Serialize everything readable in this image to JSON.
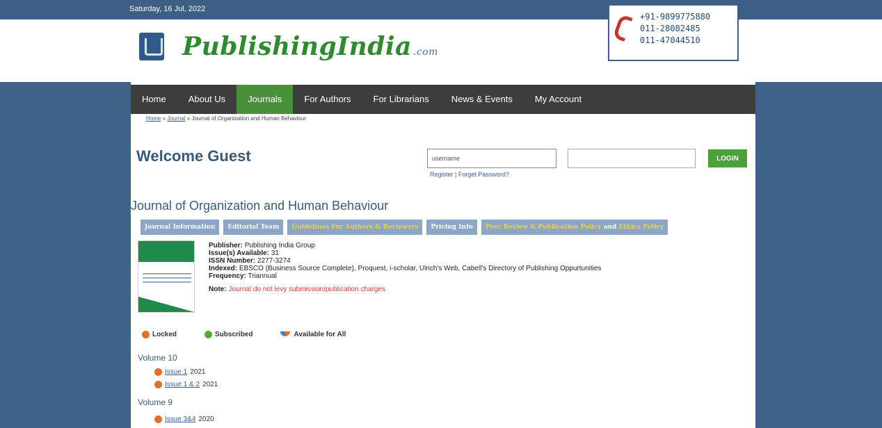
{
  "topbar": {
    "date": "Saturday, 16 Jul, 2022"
  },
  "logo": {
    "name": "PublishingIndia",
    "domain": ".com"
  },
  "contact": {
    "phones": [
      "+91-9899775880",
      "011-28082485",
      "011-47044510"
    ]
  },
  "nav": {
    "items": [
      {
        "label": "Home"
      },
      {
        "label": "About Us"
      },
      {
        "label": "Journals",
        "active": true
      },
      {
        "label": "For Authors"
      },
      {
        "label": "For Librarians"
      },
      {
        "label": "News & Events"
      },
      {
        "label": "My Account"
      }
    ]
  },
  "breadcrumb": {
    "home": "Home",
    "sep": "»",
    "journal": "Journal",
    "current": "Journal of Organization and Human Behaviour"
  },
  "login": {
    "welcome": "Welcome Guest",
    "username_value": "username",
    "login_label": "LOGIN",
    "register": "Register",
    "divider": "|",
    "forgot": "Forget Password?"
  },
  "journal": {
    "title": "Journal of Organization and Human Behaviour",
    "tabs": {
      "info": "Journal Information",
      "editorial": "Editorial Team",
      "guidelines": "Guidelines For Authors & Reviewers",
      "pricing": "Pricing Info",
      "peer_review": "Peer Review & Publication Policy",
      "and": "and",
      "ethics": "Ethics Policy"
    },
    "publisher_label": "Publisher:",
    "publisher": "Publishing India Group",
    "issues_label": "Issue(s) Available:",
    "issues": "31",
    "issn_label": "ISSN Number:",
    "issn": "2277-3274",
    "indexed_label": "Indexed:",
    "indexed": "EBSCO (Business Source Complete), Proquest, i-scholar, Ulrich's Web, Cabell's Directory of Publishing Oppurtunities",
    "frequency_label": "Frequency:",
    "frequency": "Triannual",
    "note_label": "Note:",
    "note": "Journal do not levy submission/publication charges"
  },
  "legend": {
    "locked": "Locked",
    "subscribed": "Subscribed",
    "available": "Available for All"
  },
  "volumes": [
    {
      "title": "Volume 10",
      "issues": [
        {
          "label": "Issue 1",
          "year": "2021"
        },
        {
          "label": "Issue 1 & 2",
          "year": "2021"
        }
      ]
    },
    {
      "title": "Volume 9",
      "issues": [
        {
          "label": "Issue 3&4",
          "year": "2020"
        }
      ]
    }
  ],
  "colors": {
    "header_blue": "#3d5f86",
    "nav_dark": "#3d3d3d",
    "active_green": "#4a8f3a",
    "logo_green": "#2e8b2e",
    "tab_blue": "#8aa7c8",
    "note_red": "#e23b3b"
  },
  "icons": {
    "phone": "phone-icon",
    "locked": "orange-dot-icon",
    "subscribed": "green-dot-icon",
    "available": "available-for-all-icon"
  }
}
